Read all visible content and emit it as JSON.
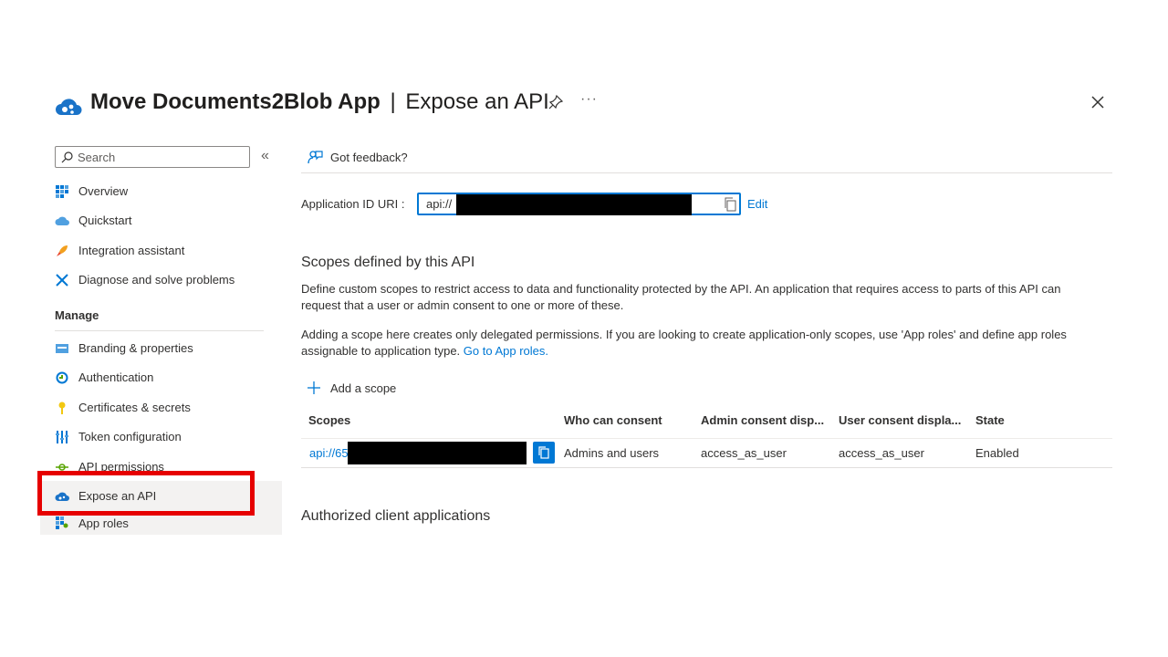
{
  "header": {
    "app_name": "Move Documents2Blob App",
    "separator": "|",
    "page_title": "Expose an API",
    "more_label": "···"
  },
  "sidebar": {
    "search_placeholder": "Search",
    "collapse_label": "«",
    "items_top": [
      {
        "label": "Overview",
        "icon": "overview-icon"
      },
      {
        "label": "Quickstart",
        "icon": "quickstart-icon"
      },
      {
        "label": "Integration assistant",
        "icon": "rocket-icon"
      },
      {
        "label": "Diagnose and solve problems",
        "icon": "wrench-icon"
      }
    ],
    "section_label": "Manage",
    "items_manage": [
      {
        "label": "Branding & properties",
        "icon": "branding-icon"
      },
      {
        "label": "Authentication",
        "icon": "authentication-icon"
      },
      {
        "label": "Certificates & secrets",
        "icon": "key-icon"
      },
      {
        "label": "Token configuration",
        "icon": "token-icon"
      },
      {
        "label": "API permissions",
        "icon": "api-permissions-icon"
      },
      {
        "label": "Expose an API",
        "icon": "cloud-icon",
        "active": true
      },
      {
        "label": "App roles",
        "icon": "app-roles-icon"
      }
    ]
  },
  "toolbar": {
    "feedback_label": "Got feedback?"
  },
  "app_id": {
    "label": "Application ID URI :",
    "value": "api://",
    "edit_label": "Edit"
  },
  "scopes": {
    "heading": "Scopes defined by this API",
    "description1": "Define custom scopes to restrict access to data and functionality protected by the API. An application that requires access to parts of this API can request that a user or admin consent to one or more of these.",
    "description2": "Adding a scope here creates only delegated permissions. If you are looking to create application-only scopes, use 'App roles' and define app roles assignable to application type. ",
    "app_roles_link": "Go to App roles.",
    "add_label": "Add a scope",
    "columns": [
      "Scopes",
      "Who can consent",
      "Admin consent disp...",
      "User consent displa...",
      "State"
    ],
    "rows": [
      {
        "scope": "api://65",
        "who": "Admins and users",
        "admin": "access_as_user",
        "user": "access_as_user",
        "state": "Enabled"
      }
    ]
  },
  "authorized": {
    "heading": "Authorized client applications"
  },
  "colors": {
    "accent": "#0078d4",
    "highlight": "#e60000"
  }
}
